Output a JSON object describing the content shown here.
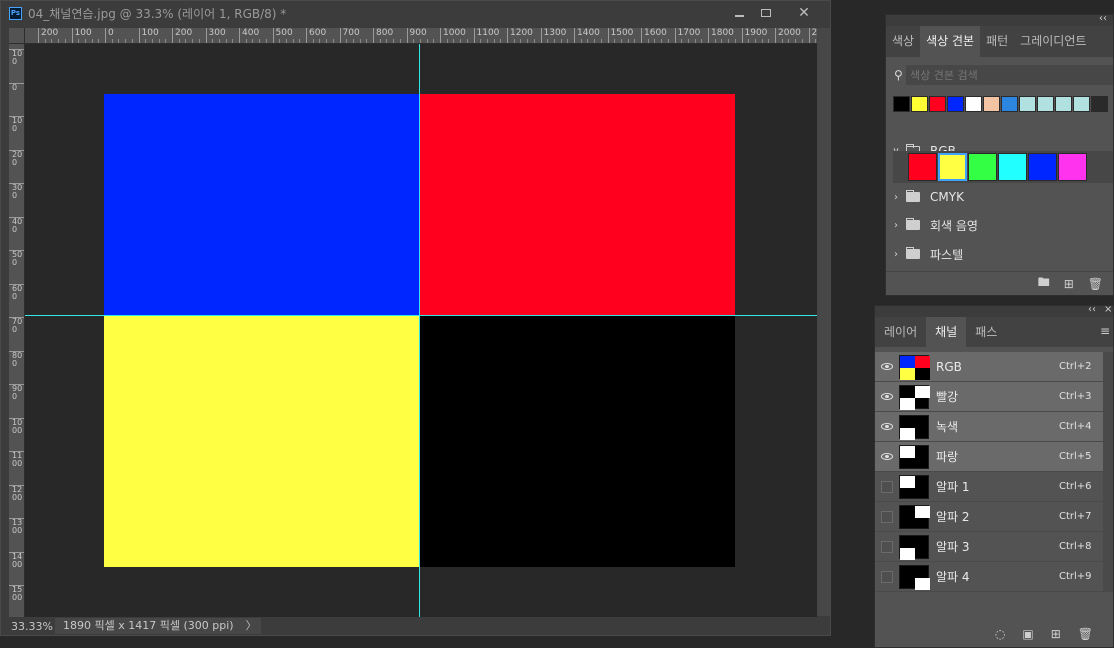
{
  "document": {
    "title": "04_채널연습.jpg @ 33.3% (레이어 1, RGB/8) *",
    "app_icon": "Ps",
    "zoom": "33.33%",
    "info": "1890 픽셀 x 1417 픽셀 (300 ppi)",
    "status_arrow": "〉",
    "ruler_h_labels": [
      "200",
      "100",
      "0",
      "100",
      "200",
      "300",
      "400",
      "500",
      "600",
      "700",
      "800",
      "900",
      "1000",
      "1100",
      "1200",
      "1300",
      "1400",
      "1500",
      "1600",
      "1700",
      "1800",
      "1900",
      "2000",
      "21"
    ],
    "ruler_v_labels": [
      "100",
      "0",
      "100",
      "200",
      "300",
      "400",
      "500",
      "600",
      "700",
      "800",
      "900",
      "1000",
      "1100",
      "1200",
      "1300",
      "1400",
      "1500"
    ],
    "canvas_colors": {
      "top_left": "#0026ff",
      "top_right": "#ff001e",
      "bottom_left": "#ffff44",
      "bottom_right": "#000000"
    },
    "guide_color": "#35e6e6"
  },
  "swatches_panel": {
    "collapse": "‹‹",
    "tabs": [
      "색상",
      "색상 견본",
      "패턴",
      "그레이디언트"
    ],
    "active_tab": "색상 견본",
    "search_icon": "search-icon",
    "search_placeholder": "색상 견본 검색",
    "recent_colors": [
      "#000000",
      "#ffff33",
      "#ff001e",
      "#0026ff",
      "#ffffff",
      "#f2c4a4",
      "#2c86e0",
      "#b0e0e0",
      "#b0e0e0",
      "#b0e0e0",
      "#b0e0e0",
      "#2a2a2a"
    ],
    "groups": [
      {
        "name": "RGB",
        "expanded": true,
        "colors": [
          "#ff001e",
          "#ffff44",
          "#33ff44",
          "#22ffff",
          "#0026ff",
          "#ff33ee"
        ],
        "selected_index": 1
      },
      {
        "name": "CMYK",
        "expanded": false
      },
      {
        "name": "회색 음영",
        "expanded": false
      },
      {
        "name": "파스텔",
        "expanded": false
      }
    ],
    "footer_icons": [
      "new-group-icon",
      "new-swatch-icon",
      "trash-icon"
    ]
  },
  "channels_panel": {
    "collapse": "‹‹",
    "close": "×",
    "menu": "≡",
    "tabs": [
      "레이어",
      "채널",
      "패스"
    ],
    "active_tab": "채널",
    "channels": [
      {
        "name": "RGB",
        "shortcut": "Ctrl+2",
        "visible": true,
        "selected": true
      },
      {
        "name": "빨강",
        "shortcut": "Ctrl+3",
        "visible": true,
        "selected": true
      },
      {
        "name": "녹색",
        "shortcut": "Ctrl+4",
        "visible": true,
        "selected": true
      },
      {
        "name": "파랑",
        "shortcut": "Ctrl+5",
        "visible": true,
        "selected": true
      },
      {
        "name": "알파 1",
        "shortcut": "Ctrl+6",
        "visible": false,
        "selected": false
      },
      {
        "name": "알파 2",
        "shortcut": "Ctrl+7",
        "visible": false,
        "selected": false
      },
      {
        "name": "알파 3",
        "shortcut": "Ctrl+8",
        "visible": false,
        "selected": false
      },
      {
        "name": "알파 4",
        "shortcut": "Ctrl+9",
        "visible": false,
        "selected": false
      }
    ],
    "footer_icons": [
      "load-selection-icon",
      "save-selection-icon",
      "new-channel-icon",
      "trash-icon"
    ]
  }
}
